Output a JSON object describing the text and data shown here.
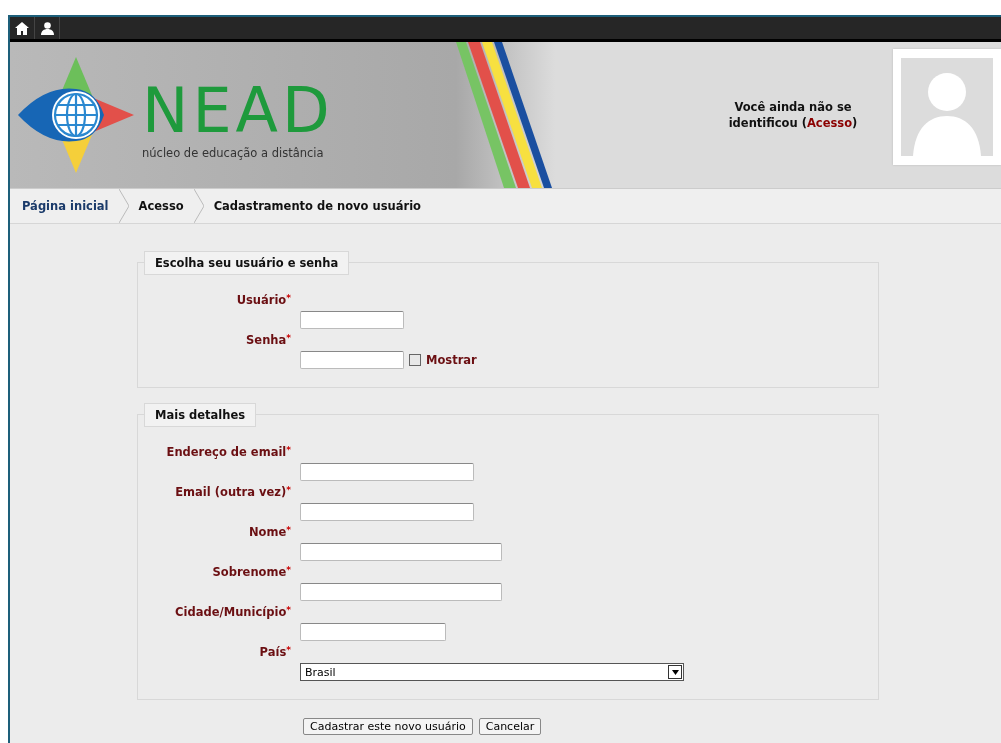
{
  "header": {
    "logo_text": "NEAD",
    "tagline": "núcleo de educação a distância",
    "login_notice": {
      "text": "Você ainda não se identificou (",
      "link": "Acesso",
      "after": ")"
    }
  },
  "breadcrumb": [
    {
      "label": "Página inicial",
      "kind": "link"
    },
    {
      "label": "Acesso",
      "kind": "text"
    },
    {
      "label": "Cadastramento de novo usuário",
      "kind": "text"
    }
  ],
  "fieldsets": [
    {
      "legend": "Escolha seu usuário e senha",
      "fields": [
        {
          "label": "Usuário",
          "mark": "*",
          "kind": "text"
        },
        {
          "label": "Senha",
          "mark": "*",
          "kind": "password",
          "show": {
            "label": "Mostrar",
            "checked": false
          }
        }
      ]
    },
    {
      "legend": "Mais detalhes",
      "fields": [
        {
          "label": "Endereço de email",
          "mark": "*",
          "kind": "text"
        },
        {
          "label": "Email (outra vez)",
          "mark": "*",
          "kind": "text"
        },
        {
          "label": "Nome",
          "mark": "*",
          "kind": "text"
        },
        {
          "label": "Sobrenome",
          "mark": "*",
          "kind": "text"
        },
        {
          "label": "Cidade/Município",
          "mark": "*",
          "kind": "text"
        },
        {
          "label": "País",
          "mark": "*",
          "kind": "select",
          "value": "Brasil"
        }
      ]
    }
  ],
  "buttons": [
    "Cadastrar este novo usuário",
    "Cancelar"
  ]
}
